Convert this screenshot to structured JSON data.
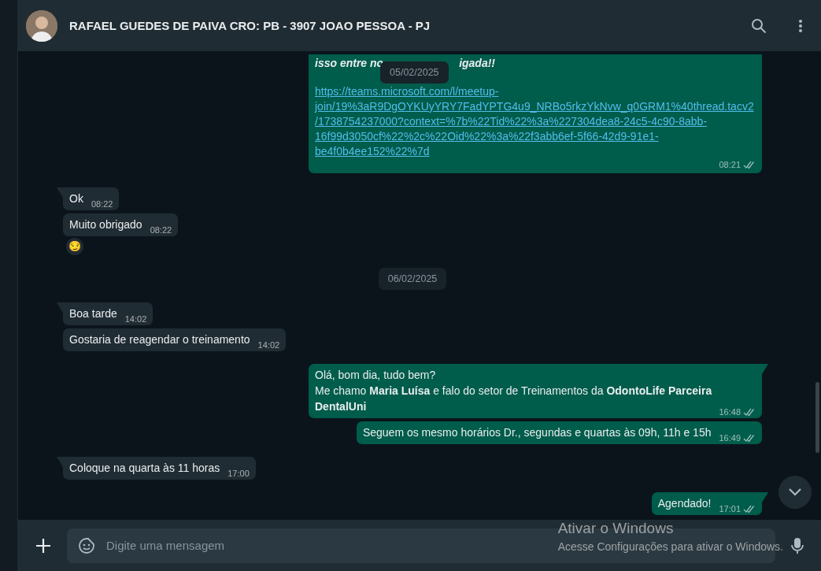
{
  "header": {
    "contact_name": "RAFAEL GUEDES DE PAIVA CRO: PB - 3907 JOAO PESSOA - PJ"
  },
  "sticky_date": "05/02/2025",
  "messages": [
    {
      "kind": "out",
      "tail": false,
      "cut_lines": [
        "isso entre no",
        "igada!!"
      ],
      "link": "https://teams.microsoft.com/l/meetup-join/19%3aR9DgOYKUyYRY7FadYPTG4u9_NRBo5rkzYkNvw_q0GRM1%40thread.tacv2/1738754237000?context=%7b%22Tid%22%3a%227304dea8-24c5-4c90-8abb-16f99d3050cf%22%2c%22Oid%22%3a%22f3abb6ef-5f66-42d9-91e1-be4f0b4ee152%22%7d",
      "time": "08:21",
      "read": true
    },
    {
      "kind": "in",
      "tail": true,
      "text": "Ok",
      "time": "08:22"
    },
    {
      "kind": "in",
      "tail": false,
      "text": "Muito obrigado",
      "time": "08:22",
      "reaction": "😏"
    },
    {
      "kind": "date",
      "text": "06/02/2025"
    },
    {
      "kind": "in",
      "tail": true,
      "text": "Boa tarde",
      "time": "14:02"
    },
    {
      "kind": "in",
      "tail": false,
      "text": "Gostaria de reagendar o treinamento",
      "time": "14:02"
    },
    {
      "kind": "out",
      "tail": true,
      "text": "Olá, bom dia, tudo bem?\nMe chamo **Maria Luísa** e falo do setor de Treinamentos da **OdontoLife Parceira DentalUni**",
      "time": "16:48",
      "read": true
    },
    {
      "kind": "out",
      "tail": false,
      "text": "Seguem os mesmo horários Dr., segundas e quartas às 09h, 11h e 15h",
      "time": "16:49",
      "read": true
    },
    {
      "kind": "in",
      "tail": true,
      "text": "Coloque na quarta às 11 horas",
      "time": "17:00"
    },
    {
      "kind": "out",
      "tail": true,
      "text": "Agendado!",
      "time": "17:01",
      "read": true
    }
  ],
  "composer": {
    "placeholder": "Digite uma mensagem"
  },
  "activation_notice": {
    "title": "Ativar o Windows",
    "text": "Acesse Configurações para ativar o Windows."
  }
}
